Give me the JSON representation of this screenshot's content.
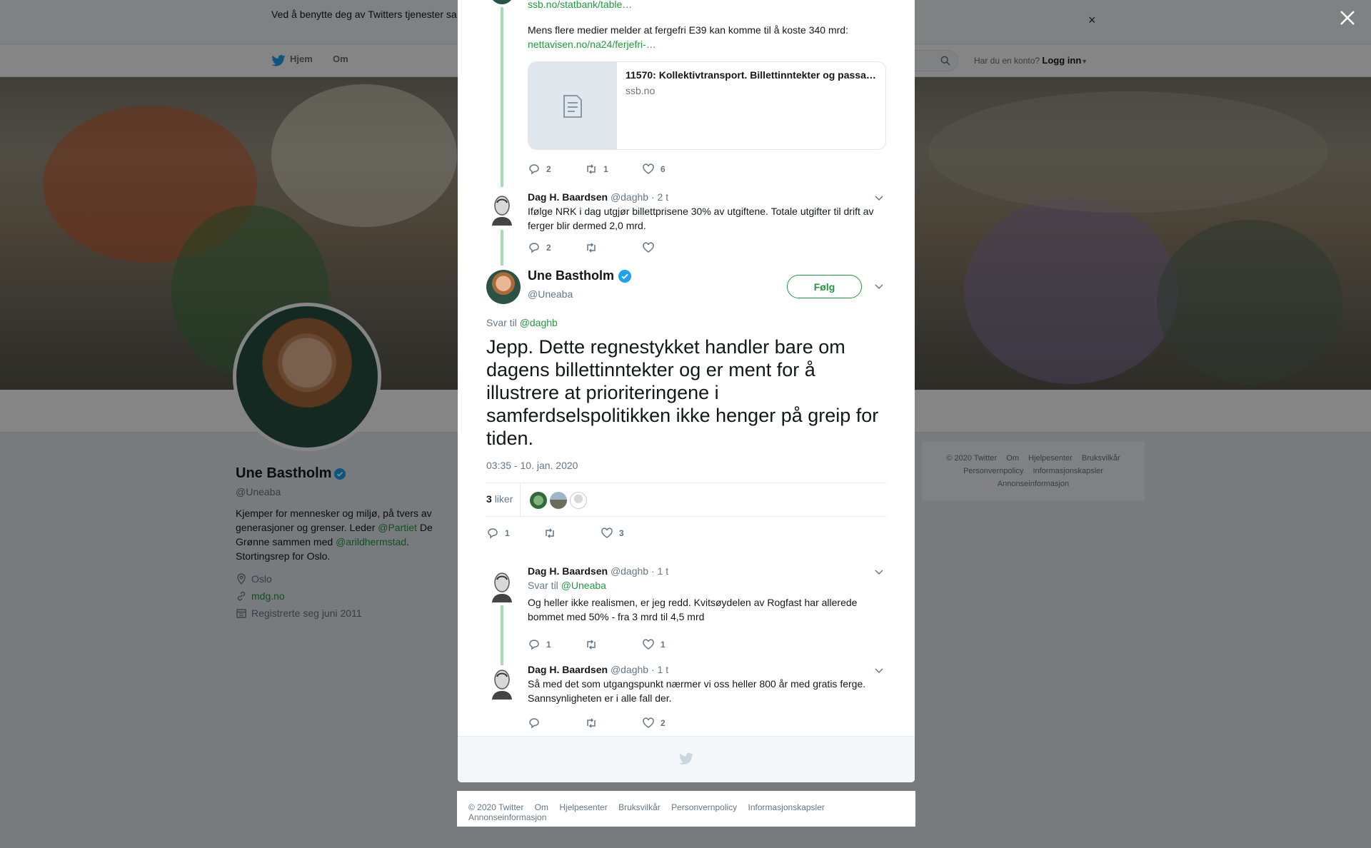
{
  "cookie_bar": {
    "text": "Ved å benytte deg av Twitters tjenester sa… informasjonskapsler til bl.a. analyser, personalisering og annonser."
  },
  "nav": {
    "home_label": "Hjem",
    "about_label": "Om",
    "account_prompt": "Har du en konto?",
    "login_label": "Logg inn"
  },
  "profile": {
    "name": "Une Bastholm",
    "handle": "@Uneaba",
    "bio_part1": "Kjemper for mennesker og miljø, på tvers av generasjoner og grenser. Leder ",
    "bio_link1": "@Partiet",
    "bio_part2": " De Grønne sammen med ",
    "bio_link2": "@arildhermstad",
    "bio_part3": ". Stortingsrep for Oslo.",
    "location": "Oslo",
    "website": "mdg.no",
    "joined": "Registrerte seg juni 2011"
  },
  "side_footer": {
    "items": [
      "© 2020 Twitter",
      "Om",
      "Hjelpesenter",
      "Bruksvilkår",
      "Personvernpolicy",
      "Informasjonskapsler",
      "Annonseinformasjon"
    ]
  },
  "thread": {
    "top_link": "ssb.no/statbank/table…",
    "top_text": "Mens flere medier melder at fergefri E39 kan komme til å koste 340 mrd:",
    "top_link2": "nettavisen.no/na24/ferjefri-…",
    "card_title": "11570: Kollektivtransport. Billettinntekter og passa…",
    "card_domain": "ssb.no",
    "top_actions": {
      "replies": "2",
      "retweets": "1",
      "likes": "6"
    },
    "tweet2": {
      "name": "Dag H. Baardsen",
      "handle": "@daghb",
      "time": "· 2 t",
      "text": "Ifølge NRK i dag utgjør billettprisene 30% av utgiftene. Totale utgifter til drift av ferger blir dermed 2,0 mrd.",
      "replies": "2"
    }
  },
  "main_tweet": {
    "name": "Une Bastholm",
    "handle": "@Uneaba",
    "follow_label": "Følg",
    "reply_prefix": "Svar til",
    "reply_to": "@daghb",
    "text": "Jepp. Dette regnestykket handler bare om dagens billettinntekter og er ment for å illustrere at prioriteringene i samferdselspolitikken ikke henger på greip for tiden.",
    "timestamp": "03:35 - 10. jan. 2020",
    "like_count": "3",
    "like_label": "liker",
    "replies": "1",
    "likes": "3"
  },
  "replies": [
    {
      "name": "Dag H. Baardsen",
      "handle": "@daghb",
      "time": "· 1 t",
      "reply_prefix": "Svar til",
      "reply_to": "@Uneaba",
      "text": "Og heller ikke realismen, er jeg redd. Kvitsøydelen av Rogfast har allerede bommet med 50% - fra 3 mrd til 4,5 mrd",
      "replies": "1",
      "likes": "1"
    },
    {
      "name": "Dag H. Baardsen",
      "handle": "@daghb",
      "time": "· 1 t",
      "text": "Så med det som utgangspunkt nærmer vi oss heller 800 år med gratis ferge. Sannsynligheten er i alle fall der.",
      "likes": "2"
    }
  ],
  "bottom_footer": {
    "items": [
      "© 2020 Twitter",
      "Om",
      "Hjelpesenter",
      "Bruksvilkår",
      "Personvernpolicy",
      "Informasjonskapsler",
      "Annonseinformasjon"
    ]
  },
  "colors": {
    "link_green": "#1f9a3f",
    "thread_line": "#a8dcb2",
    "verified_blue": "#1da1f2"
  }
}
